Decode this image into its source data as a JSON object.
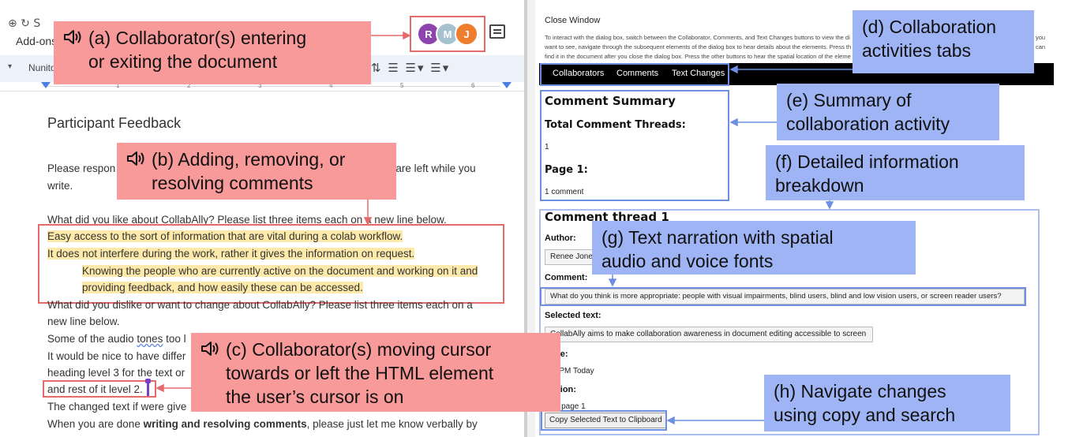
{
  "docs": {
    "toolbar_top_icons": "⊕ ↻ S",
    "addons_label": "Add-ons",
    "font_name": "Nunito",
    "toolbar_tools": "⇅ ☰ ☰▾ ☰▾",
    "ruler_marks": [
      "1",
      "2",
      "3",
      "4",
      "5",
      "6"
    ],
    "avatars": [
      {
        "initial": "R",
        "color": "#8e44ad"
      },
      {
        "initial": "M",
        "color": "#a7c2cf"
      },
      {
        "initial": "J",
        "color": "#ec7e2e"
      }
    ],
    "title": "Participant Feedback",
    "lines": {
      "l1a": "Please respon",
      "l1b": "at are left while you",
      "l2": "write.",
      "l3": "What did you like about CollabAlly? Please list three items each on a new line below.",
      "l4": "Easy access to the sort of information that are vital during a colab workflow.",
      "l5": "It does not interfere during the work, rather it gives the information on request.",
      "l6": "Knowing the people who are currently active on the document and working on it and",
      "l7": "providing feedback, and how easily these can be accessed.",
      "l8": "What did you dislike or want to change about CollabAlly? Please list three items each on a",
      "l9": "new line below.",
      "l10a": "Some of the audio ",
      "l10b": "tones",
      "l10c": " too l",
      "l11": "It would be nice to have differ",
      "l12": "heading level 3 for the text or",
      "l13": "and rest of it level 2.",
      "l14": "The changed text if were give",
      "l15a": "When you are done ",
      "l15b": "writing and resolving comments",
      "l15c": ", please just let me know verbally by"
    }
  },
  "dialog": {
    "close_window": "Close Window",
    "instructions": [
      "To interact with the dialog box, switch between the Collaborator, Comments, and Text Changes buttons to view the di",
      "want to see, navigate through the subsequent elements of the dialog box to hear details about the elements. Press th",
      "find it in the document after you close the dialog box. Press the other buttons to hear the spatial location of the eleme"
    ],
    "instructions_right": [
      "you",
      "can"
    ],
    "tabs": [
      "Collaborators",
      "Comments",
      "Text Changes"
    ],
    "summary_heading": "Comment Summary",
    "total_heading": "Total Comment Threads:",
    "total_value": "1",
    "page_heading": "Page 1:",
    "page_value": "1 comment",
    "thread_heading": "Comment thread 1",
    "author_label": "Author:",
    "author_value": "Renee Jones",
    "comment_label": "Comment:",
    "comment_value": "What do you think is more appropriate: people with visual impairments, blind users, blind and low vision users, or screen reader users?",
    "selected_label": "Selected text:",
    "selected_value": "CollabAlly aims to make collaboration awareness in document editing accessible to screen",
    "time_label": "me:",
    "time_value": "5 PM Today",
    "location_label": "ation:",
    "location_value": "of page 1",
    "copy_button": "Copy Selected Text to Clipboard"
  },
  "callouts": {
    "a": [
      "(a) Collaborator(s) entering",
      "or exiting the document"
    ],
    "b": [
      "(b) Adding, removing, or",
      "resolving comments"
    ],
    "c": [
      "(c) Collaborator(s) moving cursor",
      "towards or left the HTML element",
      "the user’s cursor is on"
    ],
    "d": [
      "(d) Collaboration",
      "activities tabs"
    ],
    "e": [
      "(e) Summary of",
      "collaboration activity"
    ],
    "f": [
      "(f) Detailed information",
      "breakdown"
    ],
    "g": [
      "(g) Text narration with spatial",
      "audio and voice fonts"
    ],
    "h": [
      "(h) Navigate changes",
      "using copy and search"
    ]
  },
  "colors": {
    "red_callout": "#f79a99",
    "blue_callout": "#9fb4f4",
    "red_border": "#e56a6a",
    "blue_border": "#6d8fe3",
    "doc_highlight": "#fde9a9"
  },
  "icons": [
    "speaker-icon",
    "comment-icon",
    "cursor-icon"
  ]
}
